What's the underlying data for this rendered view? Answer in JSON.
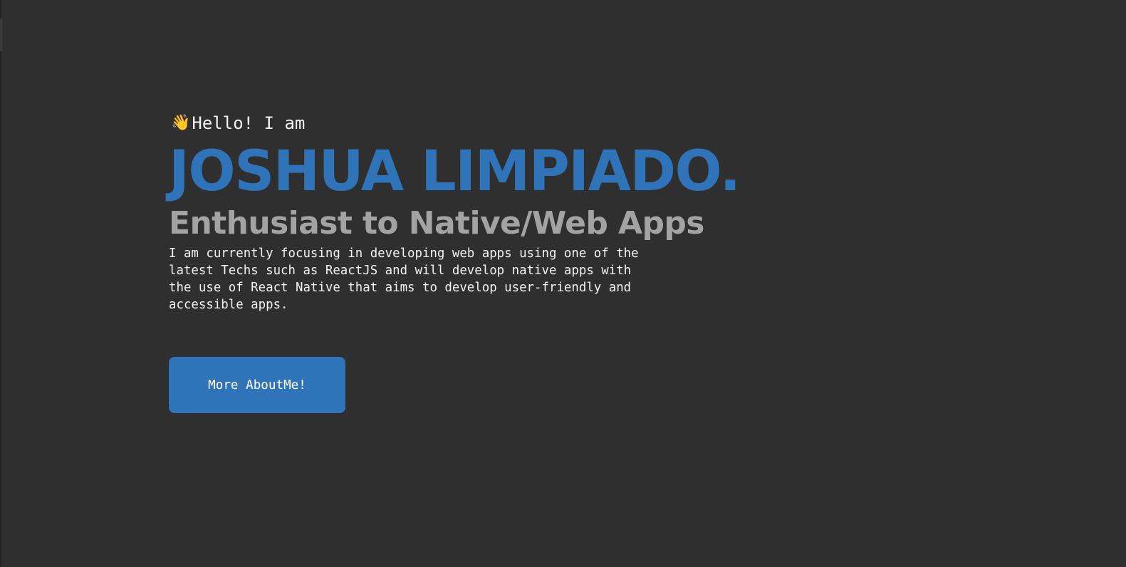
{
  "hero": {
    "greeting": "Hello! I am",
    "name": "JOSHUA LIMPIADO.",
    "subtitle": "Enthusiast to Native/Web Apps",
    "description": "I am currently focusing in developing web apps using one of the latest Techs such as ReactJS and will develop native apps with the use of React Native that aims to develop user-friendly and accessible apps.",
    "cta_label": "More AboutMe!"
  },
  "icons": {
    "greeting_icon": "waving-hand-icon"
  },
  "colors": {
    "background": "#2f2f2f",
    "accent": "#2f73b8",
    "subtitle": "#a3a3a3",
    "text": "#f2f2f2"
  }
}
